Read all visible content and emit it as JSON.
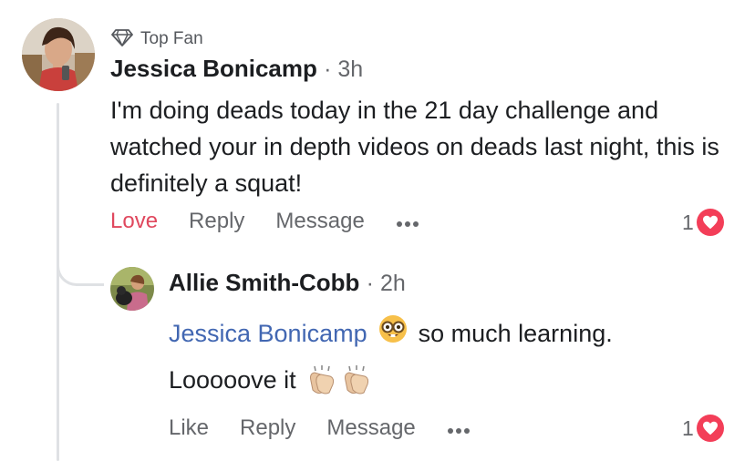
{
  "comment": {
    "badge": "Top Fan",
    "author": "Jessica Bonicamp",
    "time": "3h",
    "text": "I'm doing deads today in the 21 day challenge and watched your in depth videos on deads last night, this is definitely a squat!",
    "actions": {
      "love": "Love",
      "reply": "Reply",
      "message": "Message"
    },
    "reaction_count": "1",
    "reaction_icon": "heart-icon"
  },
  "reply": {
    "author": "Allie Smith-Cobb",
    "time": "2h",
    "mention": "Jessica Bonicamp",
    "line1_text": "so much learning.",
    "line2_text": "Looooove it",
    "emoji_nerd": "nerd-face-emoji",
    "emoji_clap": "clapping-hands-emoji",
    "actions": {
      "like": "Like",
      "reply": "Reply",
      "message": "Message"
    },
    "reaction_count": "1",
    "reaction_icon": "heart-icon"
  },
  "colors": {
    "love": "#e0485e",
    "mention": "#4267b2",
    "heart": "#f33e58",
    "meta": "#65676b"
  }
}
